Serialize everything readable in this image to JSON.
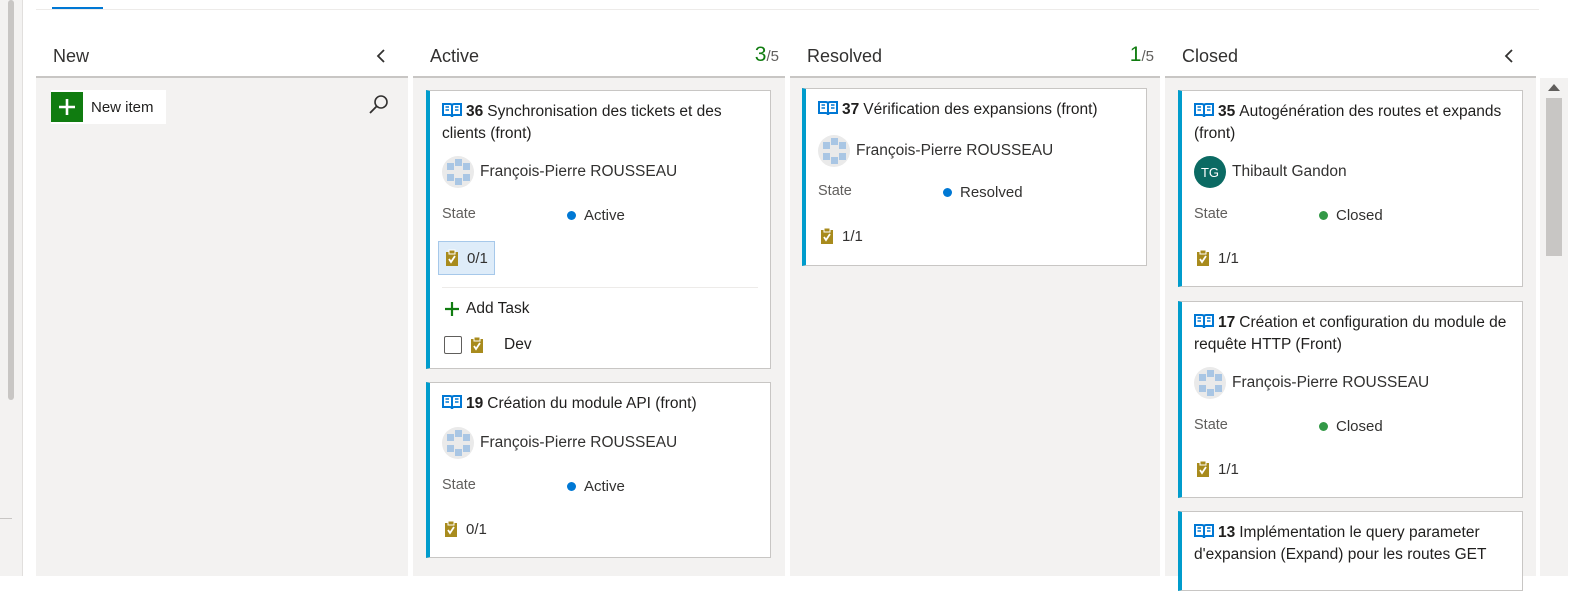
{
  "board": {
    "columns": [
      {
        "title": "New",
        "new_item_label": "New item"
      },
      {
        "title": "Active",
        "count": "3",
        "limit": "/5"
      },
      {
        "title": "Resolved",
        "count": "1",
        "limit": "/5"
      },
      {
        "title": "Closed"
      }
    ]
  },
  "cards": {
    "c36": {
      "id": "36",
      "title": "Synchronisation des tickets et des clients (front)",
      "assignee": "François-Pierre ROUSSEAU",
      "state_label": "State",
      "state": "Active",
      "tasks": "0/1",
      "add_task": "Add Task",
      "child_task": "Dev"
    },
    "c19": {
      "id": "19",
      "title": "Création du module API (front)",
      "assignee": "François-Pierre ROUSSEAU",
      "state_label": "State",
      "state": "Active",
      "tasks": "0/1"
    },
    "c37": {
      "id": "37",
      "title": "Vérification des expansions (front)",
      "assignee": "François-Pierre ROUSSEAU",
      "state_label": "State",
      "state": "Resolved",
      "tasks": "1/1"
    },
    "c35": {
      "id": "35",
      "title": "Autogénération des routes et expands (front)",
      "assignee": "Thibault Gandon",
      "assignee_initials": "TG",
      "state_label": "State",
      "state": "Closed",
      "tasks": "1/1"
    },
    "c17": {
      "id": "17",
      "title": "Création et configuration du module de requête HTTP (Front)",
      "assignee": "François-Pierre ROUSSEAU",
      "state_label": "State",
      "state": "Closed",
      "tasks": "1/1"
    },
    "c13": {
      "id": "13",
      "title": "Implémentation le query parameter d'expansion (Expand)  pour les routes GET"
    }
  },
  "colors": {
    "active": "#0078d4",
    "resolved": "#0078d4",
    "closed": "#339947",
    "accent": "#009ccc",
    "count": "#107c10"
  },
  "icons": {
    "card": "book-icon",
    "tasks": "clipboard-check-icon",
    "collapse": "chevron-left-icon",
    "search": "search-icon",
    "add": "plus-icon"
  }
}
